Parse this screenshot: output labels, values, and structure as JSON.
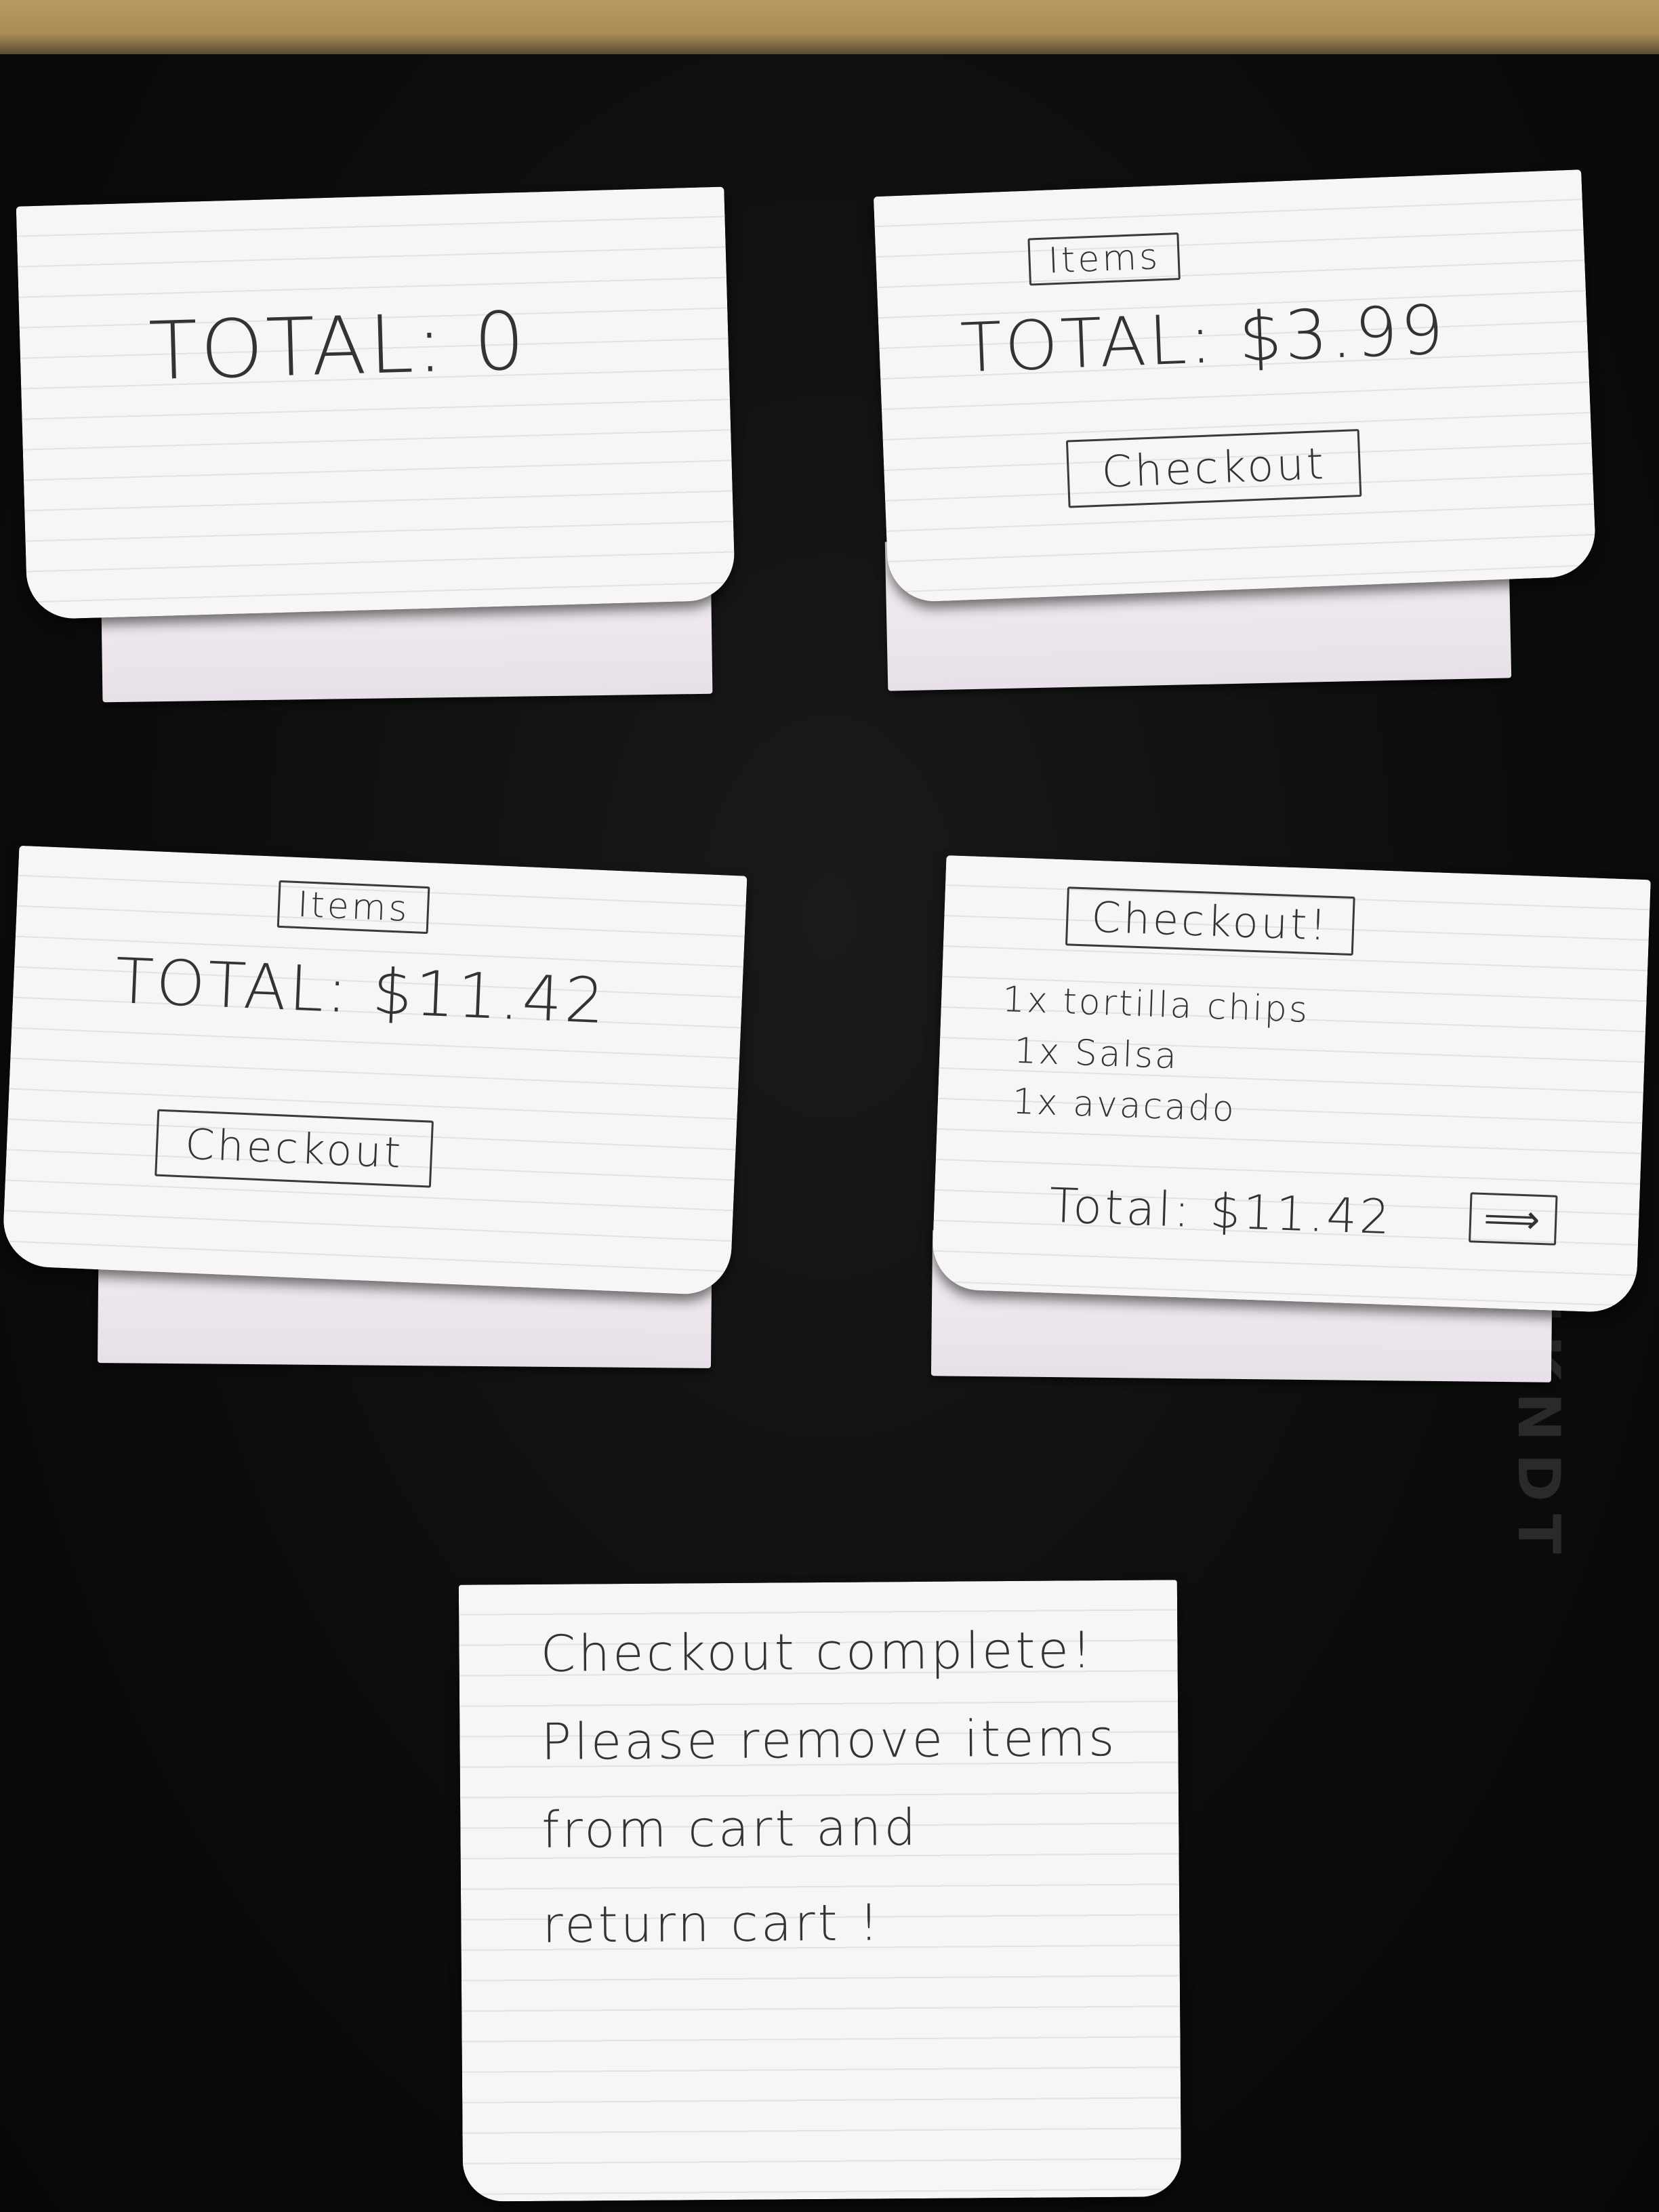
{
  "screens": {
    "empty": {
      "total_label": "TOTAL: 0"
    },
    "one_item": {
      "items_button": "Items",
      "total_label": "TOTAL: $3.99",
      "checkout_button": "Checkout"
    },
    "three_items": {
      "items_button": "Items",
      "total_label": "TOTAL: $11.42",
      "checkout_button": "Checkout"
    },
    "checkout": {
      "header": "Checkout!",
      "items": [
        "1x tortilla chips",
        "1x Salsa",
        "1x avacado"
      ],
      "total_label": "Total: $11.42",
      "next_button": "⟹"
    },
    "complete": {
      "message_lines": [
        "Checkout complete!",
        "Please remove items",
        "from cart and",
        "return cart !"
      ]
    }
  },
  "background_text": "IKNDT"
}
